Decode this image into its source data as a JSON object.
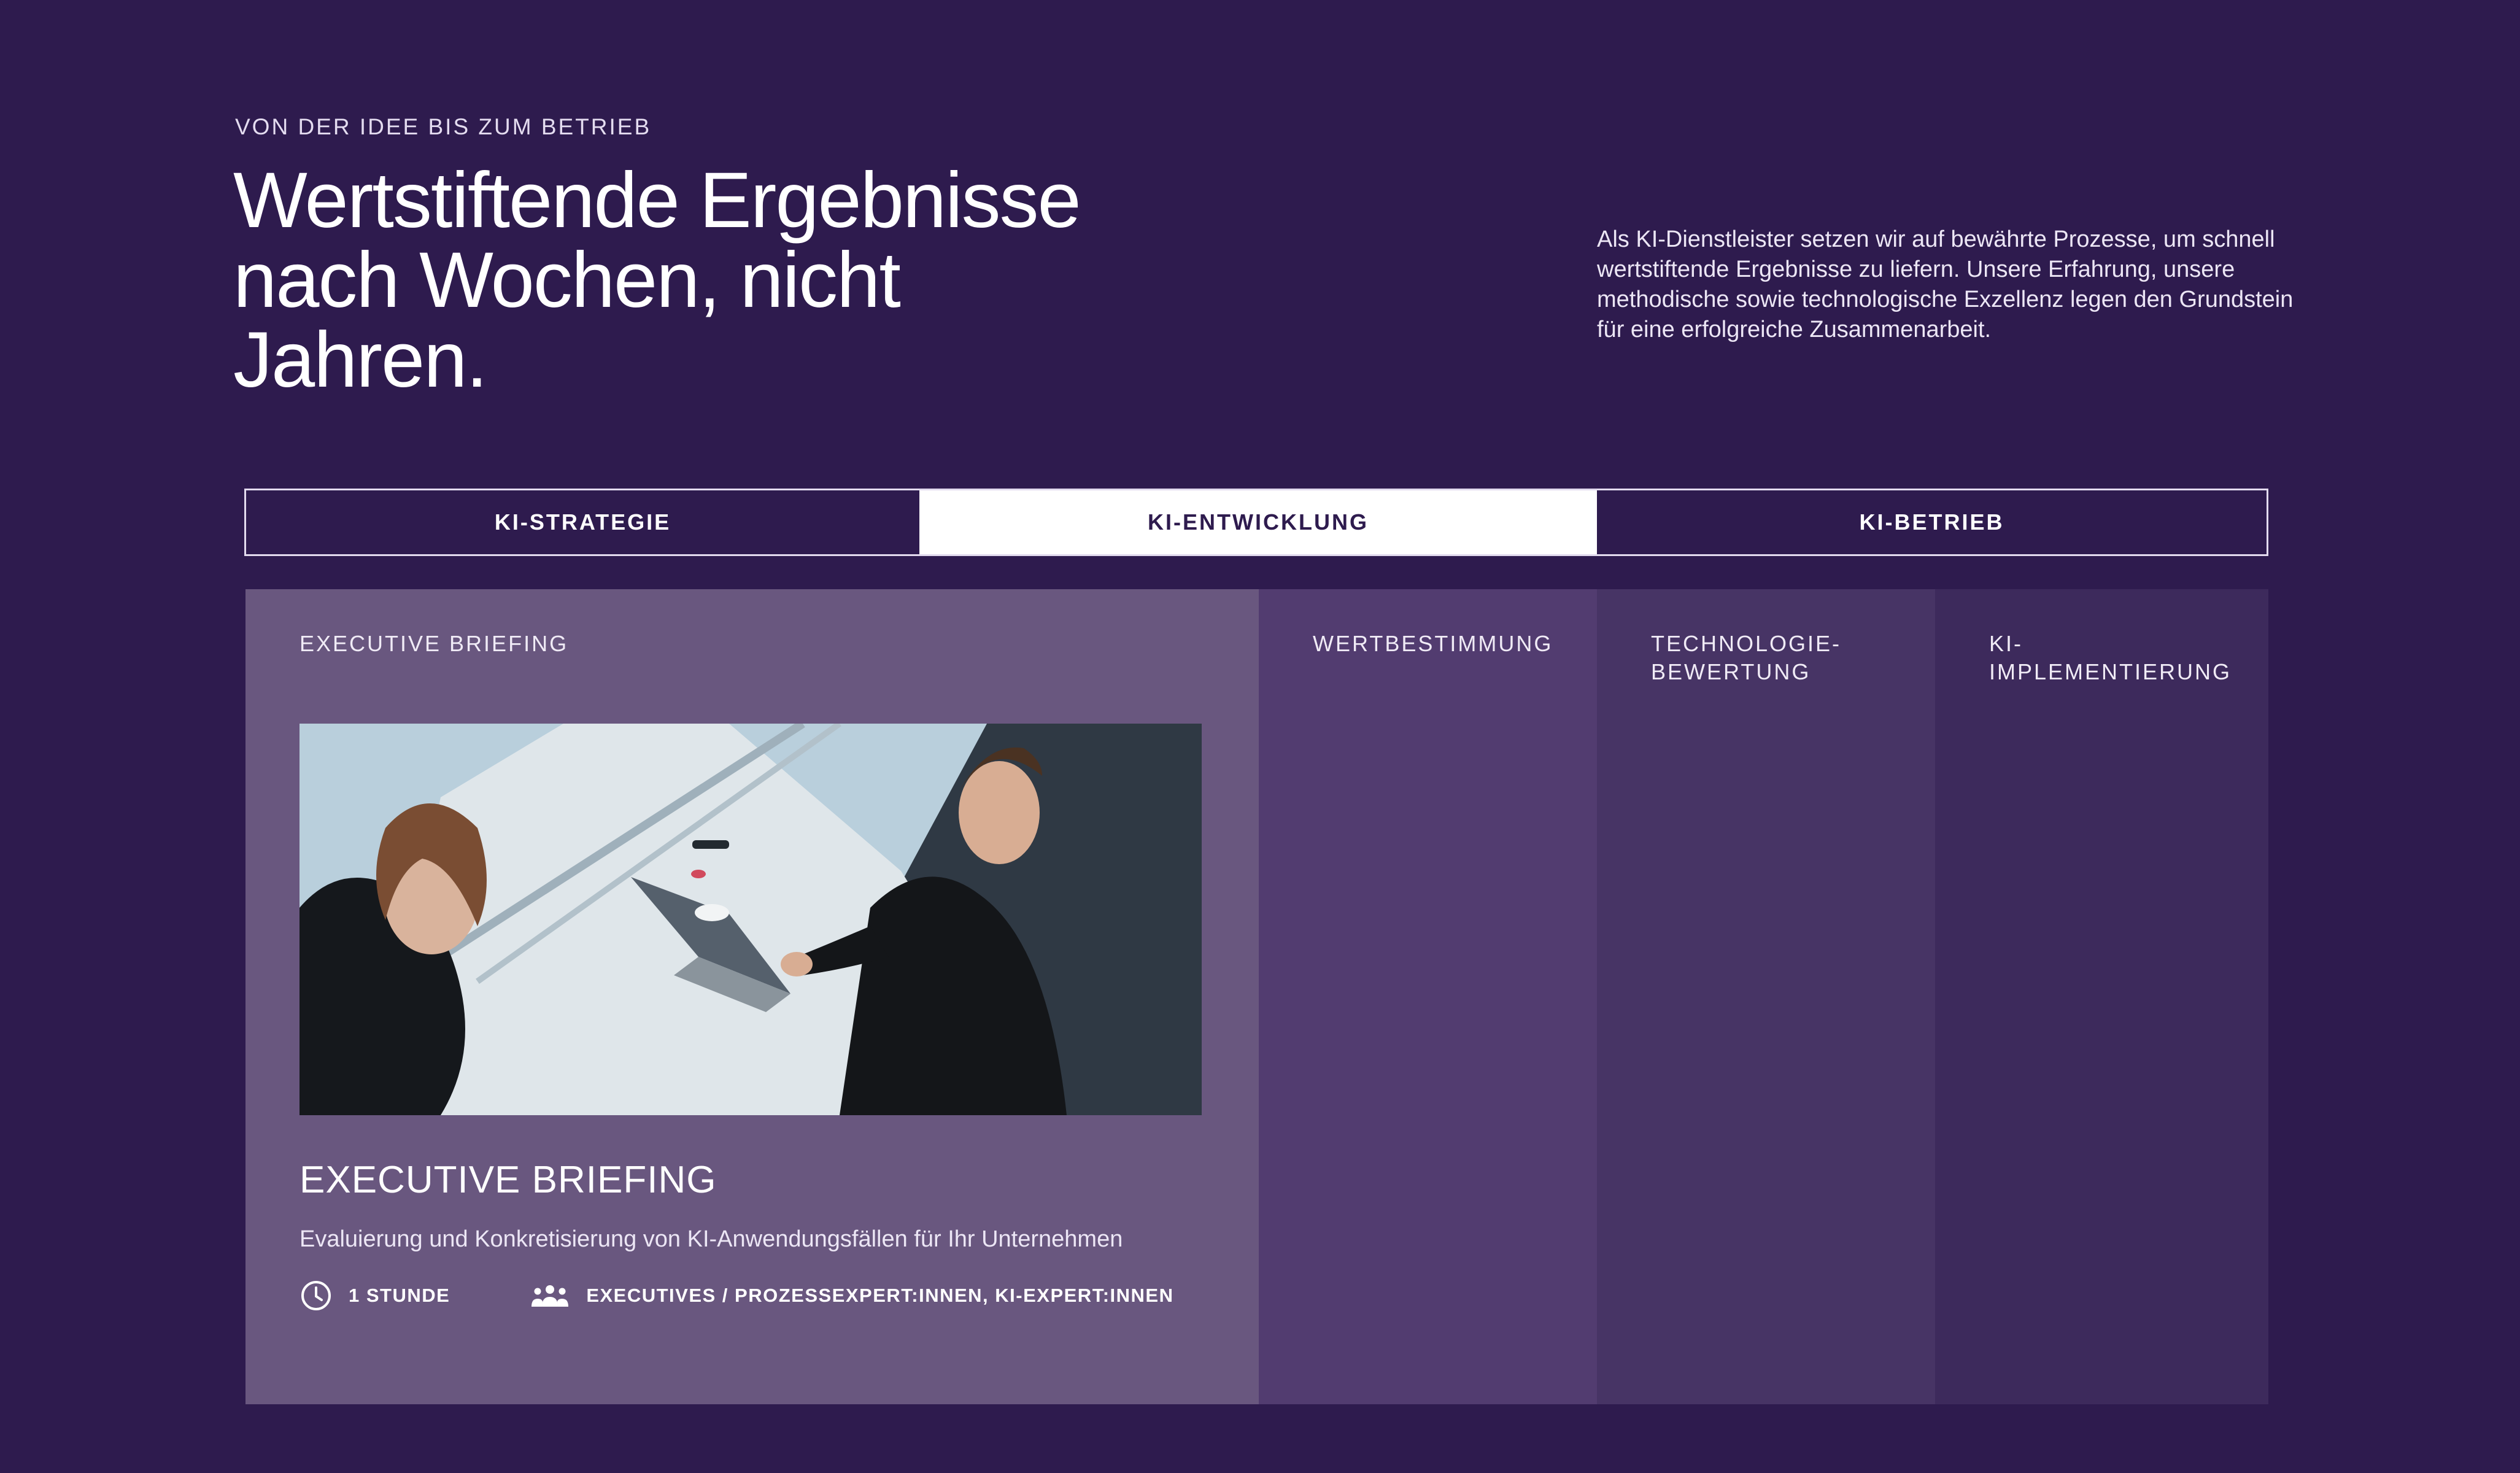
{
  "hero": {
    "eyebrow": "VON DER IDEE BIS ZUM BETRIEB",
    "headline": "Wertstiftende Ergebnisse nach Wochen, nicht Jahren.",
    "intro": "Als KI-Dienstleister setzen wir auf bewährte Prozesse, um schnell wertstiftende Ergebnisse zu liefern. Unsere Erfahrung, unsere methodische sowie technologische Exzellenz legen den Grundstein für eine erfolgreiche Zusammenarbeit."
  },
  "tabs": [
    {
      "label": "KI-STRATEGIE",
      "active": false
    },
    {
      "label": "KI-ENTWICKLUNG",
      "active": true
    },
    {
      "label": "KI-BETRIEB",
      "active": false
    }
  ],
  "panels": [
    {
      "label": "EXECUTIVE BRIEFING",
      "expanded": true
    },
    {
      "label": "WERTBESTIMMUNG",
      "expanded": false
    },
    {
      "label": "TECHNOLOGIE-\nBEWERTUNG",
      "expanded": false
    },
    {
      "label": "KI-\nIMPLEMENTIERUNG",
      "expanded": false
    }
  ],
  "card": {
    "title": "EXECUTIVE BRIEFING",
    "description": "Evaluierung und Konkretisierung von KI-Anwendungsfällen für Ihr Unternehmen",
    "duration": "1 STUNDE",
    "audience": "EXECUTIVES / PROZESSEXPERT:INNEN, KI-EXPERT:INNEN",
    "duration_icon": "clock-icon",
    "audience_icon": "people-group-icon"
  },
  "colors": {
    "background": "#2e1b4e",
    "active_tab": "#ffffff",
    "panel_expanded": "#69577f",
    "panel_2": "#523c70",
    "panel_3": "#473465",
    "panel_4": "#3d2a5c"
  }
}
